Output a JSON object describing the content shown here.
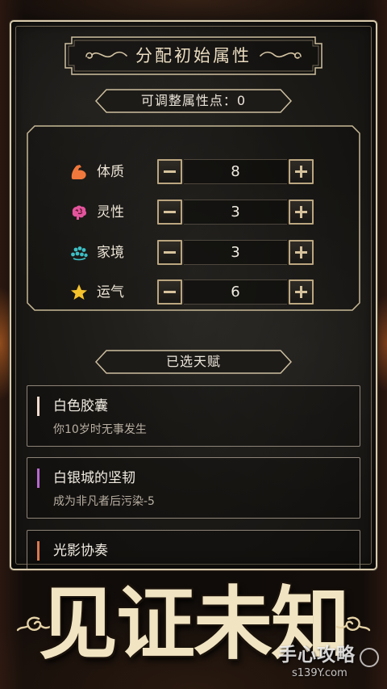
{
  "header": {
    "title": "分配初始属性",
    "points_label": "可调整属性点：",
    "points_value": "0"
  },
  "attributes": [
    {
      "name": "体质",
      "value": "8",
      "icon": "muscle-icon",
      "color": "#f0783c"
    },
    {
      "name": "灵性",
      "value": "3",
      "icon": "brain-icon",
      "color": "#e3549c"
    },
    {
      "name": "家境",
      "value": "3",
      "icon": "coins-icon",
      "color": "#3dbfc6"
    },
    {
      "name": "运气",
      "value": "6",
      "icon": "star-icon",
      "color": "#f6c22c"
    }
  ],
  "stepper": {
    "decrease_icon": "minus-icon",
    "increase_icon": "plus-icon"
  },
  "talents": {
    "header": "已选天赋",
    "items": [
      {
        "title": "白色胶囊",
        "desc": "你10岁时无事发生",
        "accent": "#f2dccf"
      },
      {
        "title": "白银城的坚韧",
        "desc": "成为非凡者后污染-5",
        "accent": "#b868cf"
      },
      {
        "title": "光影协奏",
        "accent": "#d97a4e"
      }
    ]
  },
  "banner": {
    "logo_text": "见证未知"
  },
  "watermark": {
    "brand": "手心攻略",
    "site": "s139Y.com"
  },
  "theme": {
    "frame": "#d8cbad",
    "panel": "#1c1a17",
    "text": "#ece5d8",
    "subtext": "#b8afa2",
    "logo_gold": "#f1e4c2"
  }
}
